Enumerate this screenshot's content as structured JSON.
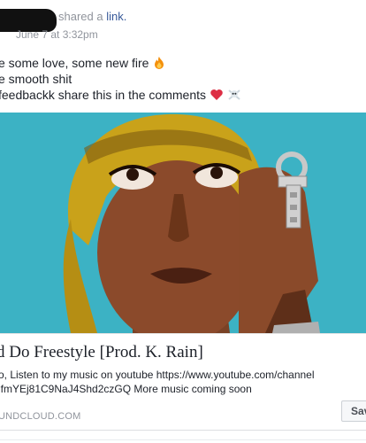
{
  "post": {
    "author_redacted": true,
    "shared_text": "shared a",
    "shared_link": "link.",
    "timestamp": "June 7 at 3:32pm",
    "lines": [
      {
        "text": "e some love, some new fire",
        "emoji": "fire-emoji"
      },
      {
        "text": "e smooth shit",
        "emoji": ""
      },
      {
        "text": "feedbackk share this in the comments",
        "emoji": "heart-skull-emoji"
      }
    ]
  },
  "preview": {
    "title": "d Do Freestyle [Prod. K. Rain]",
    "description_line1": "o, Listen to my music on youtube https://www.youtube.com/channel",
    "description_line2": "lfmYEj81C9NaJ4Shd2czGQ More music coming soon",
    "source": "UNDCLOUD.COM",
    "save_label": "Sav"
  },
  "colors": {
    "link": "#365899",
    "meta": "#90949c",
    "media_bg": "#3cb2c4"
  }
}
